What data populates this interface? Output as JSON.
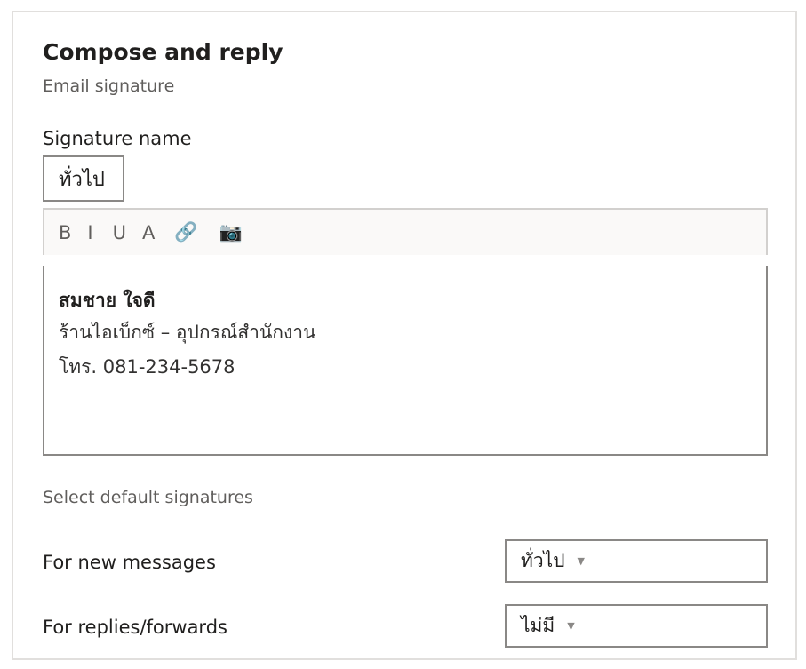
{
  "section": {
    "title": "Compose and reply",
    "subtitle": "Email signature"
  },
  "signature_name": {
    "label": "Signature name",
    "value": "ทั่วไป"
  },
  "toolbar": {
    "bold": "B",
    "italic": "I",
    "underline": "U",
    "font_color": "A",
    "link_icon": "🔗",
    "image_icon": "📷"
  },
  "editor": {
    "line1": "สมชาย ใจดี",
    "line2": "ร้านไอเบ็กซ์ – อุปกรณ์สำนักงาน",
    "line3": "โทร. 081-234-5678"
  },
  "defaults": {
    "label": "Select default signatures",
    "new_messages_label": "For new messages",
    "new_messages_value": "ทั่วไป",
    "replies_label": "For replies/forwards",
    "replies_value": "ไม่มี",
    "caret": "▼"
  }
}
